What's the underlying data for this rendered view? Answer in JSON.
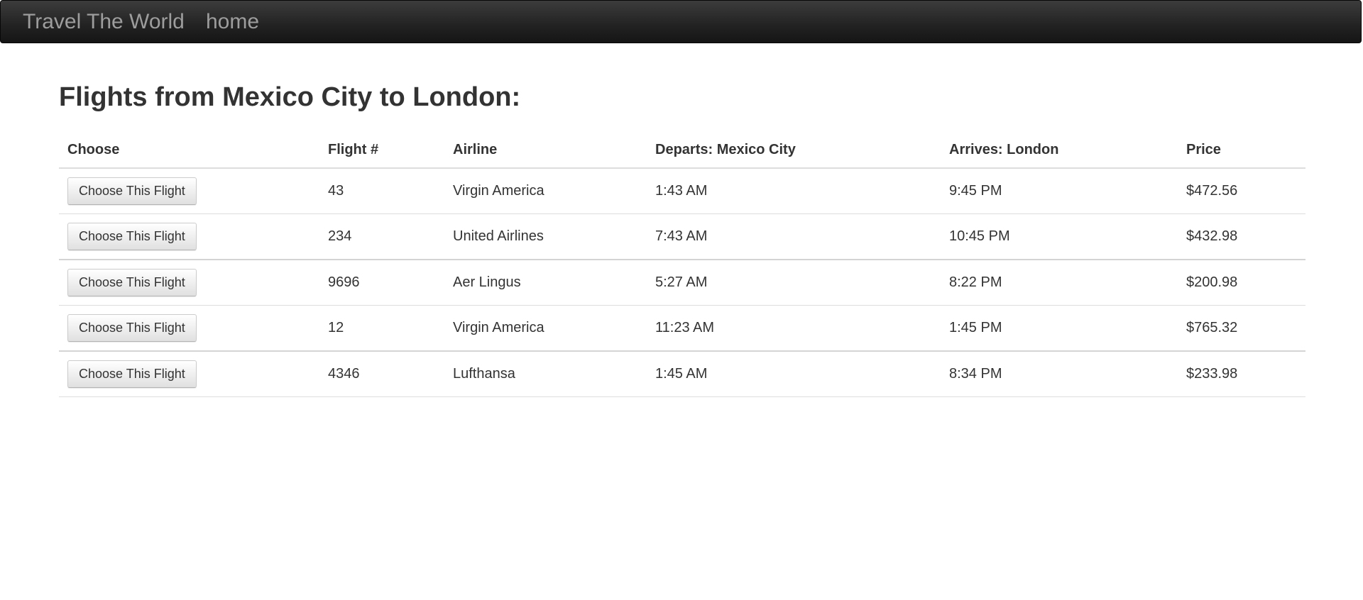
{
  "navbar": {
    "brand": "Travel The World",
    "home_link": "home"
  },
  "page": {
    "title": "Flights from Mexico City to London:"
  },
  "table": {
    "headers": [
      "Choose",
      "Flight #",
      "Airline",
      "Departs: Mexico City",
      "Arrives: London",
      "Price"
    ],
    "choose_label": "Choose This Flight",
    "rows": [
      {
        "flight": "43",
        "airline": "Virgin America",
        "departs": "1:43 AM",
        "arrives": "9:45 PM",
        "price": "$472.56"
      },
      {
        "flight": "234",
        "airline": "United Airlines",
        "departs": "7:43 AM",
        "arrives": "10:45 PM",
        "price": "$432.98"
      },
      {
        "flight": "9696",
        "airline": "Aer Lingus",
        "departs": "5:27 AM",
        "arrives": "8:22 PM",
        "price": "$200.98"
      },
      {
        "flight": "12",
        "airline": "Virgin America",
        "departs": "11:23 AM",
        "arrives": "1:45 PM",
        "price": "$765.32"
      },
      {
        "flight": "4346",
        "airline": "Lufthansa",
        "departs": "1:45 AM",
        "arrives": "8:34 PM",
        "price": "$233.98"
      }
    ]
  }
}
